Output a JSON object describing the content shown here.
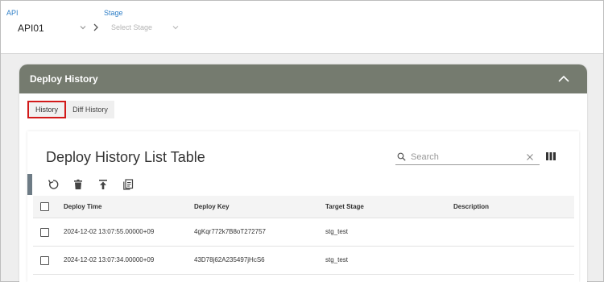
{
  "selector": {
    "api_label": "API",
    "api_value": "API01",
    "stage_label": "Stage",
    "stage_placeholder": "Select Stage"
  },
  "panel": {
    "title": "Deploy History",
    "tabs": [
      "History",
      "Diff History"
    ],
    "active_tab": "History"
  },
  "table": {
    "title": "Deploy History List Table",
    "search_placeholder": "Search",
    "toolbar_icons": [
      "refresh-icon",
      "delete-icon",
      "deploy-icon",
      "copy-icon"
    ],
    "columns": [
      "Deploy Time",
      "Deploy Key",
      "Target Stage",
      "Description"
    ],
    "rows": [
      {
        "time": "2024-12-02 13:07:55.00000+09",
        "key": "4gKqr772k7B8oT272757",
        "stage": "stg_test",
        "description": ""
      },
      {
        "time": "2024-12-02 13:07:34.00000+09",
        "key": "43D78j62A235497jHcS6",
        "stage": "stg_test",
        "description": ""
      }
    ]
  },
  "colors": {
    "header_bg": "#757b6f",
    "link_label": "#2f7fc7",
    "active_tab_border": "#d21a1a"
  }
}
